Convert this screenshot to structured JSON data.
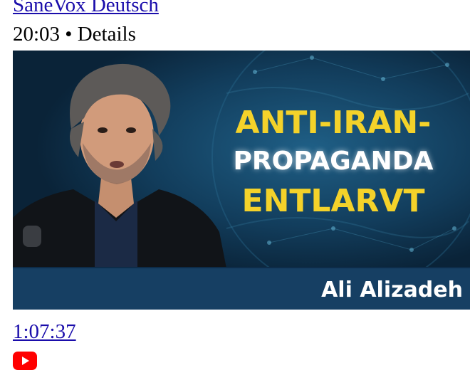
{
  "video": {
    "channel": "SaneVox Deutsch",
    "meta": "20:03 • Details",
    "duration_link": "1:07:37"
  },
  "thumbnail": {
    "headline_line1": "ANTI-IRAN-",
    "headline_line2": "PROPAGANDA",
    "headline_line3": "ENTLARVT",
    "presenter": "Ali Alizadeh"
  },
  "colors": {
    "link": "#1a0dab",
    "thumb_background": "#0b2a44",
    "headline_yellow": "#f4d22a",
    "youtube_red": "#ff0000"
  },
  "icons": {
    "source": "youtube-logo-icon"
  }
}
